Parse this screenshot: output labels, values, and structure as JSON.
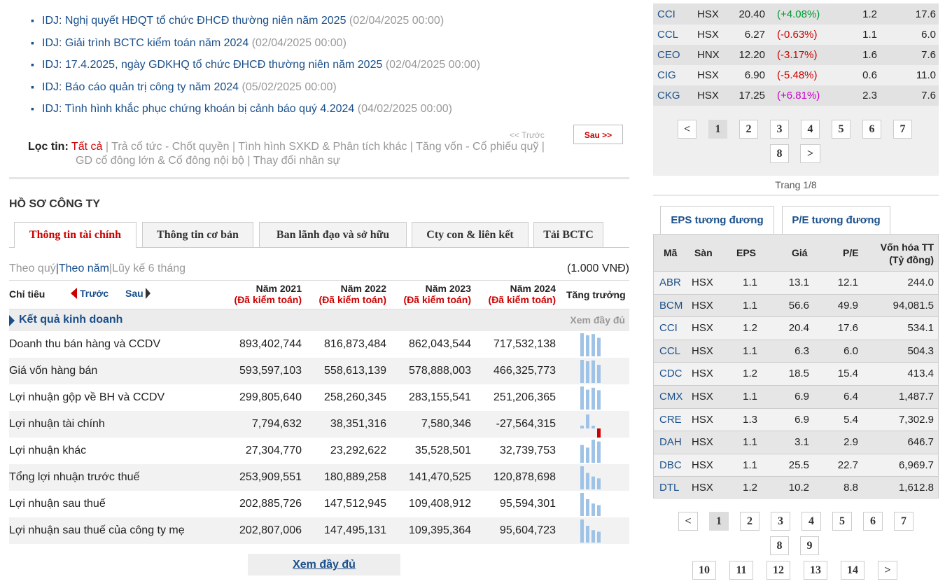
{
  "news": {
    "items": [
      {
        "text": "IDJ: Nghị quyết HĐQT tổ chức ĐHCĐ thường niên năm 2025",
        "date": "(02/04/2025 00:00)"
      },
      {
        "text": "IDJ: Giải trình BCTC kiểm toán năm 2024",
        "date": "(02/04/2025 00:00)"
      },
      {
        "text": "IDJ: 17.4.2025, ngày GDKHQ tổ chức ĐHCĐ thường niên năm 2025",
        "date": "(02/04/2025 00:00)"
      },
      {
        "text": "IDJ: Báo cáo quản trị công ty năm 2024",
        "date": "(05/02/2025 00:00)"
      },
      {
        "text": "IDJ: Tình hình khắc phục chứng khoán bị cảnh báo quý 4.2024",
        "date": "(04/02/2025 00:00)"
      }
    ],
    "prev_label": "<< Trước",
    "next_label": "Sau >>",
    "filter": {
      "label": "Lọc tin",
      "colon": ":",
      "items": [
        "Tất cả",
        "Trả cổ tức - Chốt quyền",
        "Tình hình SXKD & Phân tích khác",
        "Tăng vốn - Cổ phiếu quỹ",
        "GD cổ đông lớn & Cổ đông nội bộ",
        "Thay đổi nhân sự"
      ],
      "separator": " | "
    }
  },
  "profile": {
    "title": "HỒ SƠ CÔNG TY",
    "tabs": [
      "Thông tin tài chính",
      "Thông tin cơ bản",
      "Ban lãnh đạo và sở hữu",
      "Cty con & liên kết",
      "Tải BCTC"
    ],
    "period": {
      "quarter": "Theo quý",
      "year": "Theo năm",
      "ytd": "Lũy kế 6 tháng",
      "sep": "|"
    },
    "unit": "(1.000 VNĐ)",
    "header": {
      "indicator": "Chỉ tiêu",
      "prev": "Trước",
      "next": "Sau",
      "growth": "Tăng trưởng",
      "years": [
        {
          "year": "Năm 2021",
          "audit": "(Đã kiểm toán)"
        },
        {
          "year": "Năm 2022",
          "audit": "(Đã kiểm toán)"
        },
        {
          "year": "Năm 2023",
          "audit": "(Đã kiểm toán)"
        },
        {
          "year": "Năm 2024",
          "audit": "(Đã kiểm toán)"
        }
      ]
    },
    "group": {
      "title": "Kết quả kinh doanh",
      "view_full": "Xem đầy đủ"
    },
    "rows": [
      {
        "name": "Doanh thu bán hàng và CCDV",
        "values": [
          "893,402,744",
          "816,873,484",
          "862,043,544",
          "717,532,138"
        ],
        "nums": [
          893402744,
          816873484,
          862043544,
          717532138
        ]
      },
      {
        "name": "Giá vốn hàng bán",
        "values": [
          "593,597,103",
          "558,613,139",
          "578,888,003",
          "466,325,773"
        ],
        "nums": [
          593597103,
          558613139,
          578888003,
          466325773
        ]
      },
      {
        "name": "Lợi nhuận gộp về BH và CCDV",
        "values": [
          "299,805,640",
          "258,260,345",
          "283,155,541",
          "251,206,365"
        ],
        "nums": [
          299805640,
          258260345,
          283155541,
          251206365
        ]
      },
      {
        "name": "Lợi nhuận tài chính",
        "values": [
          "7,794,632",
          "38,351,316",
          "7,580,346",
          "-27,564,315"
        ],
        "nums": [
          7794632,
          38351316,
          7580346,
          -27564315
        ]
      },
      {
        "name": "Lợi nhuận khác",
        "values": [
          "27,304,770",
          "23,292,622",
          "35,528,501",
          "32,739,753"
        ],
        "nums": [
          27304770,
          23292622,
          35528501,
          32739753
        ]
      },
      {
        "name": "Tổng lợi nhuận trước thuế",
        "values": [
          "253,909,551",
          "180,889,258",
          "141,470,525",
          "120,878,698"
        ],
        "nums": [
          253909551,
          180889258,
          141470525,
          120878698
        ]
      },
      {
        "name": "Lợi nhuận sau thuế",
        "values": [
          "202,885,726",
          "147,512,945",
          "109,408,912",
          "95,594,301"
        ],
        "nums": [
          202885726,
          147512945,
          109408912,
          95594301
        ]
      },
      {
        "name": "Lợi nhuận sau thuế của công ty mẹ",
        "values": [
          "202,807,006",
          "147,495,131",
          "109,395,364",
          "95,604,723"
        ],
        "nums": [
          202807006,
          147495131,
          109395364,
          95604723
        ]
      }
    ],
    "more": "Xem đầy đủ"
  },
  "quotes": {
    "rows": [
      {
        "ticker": "CCI",
        "exchange": "HSX",
        "price": "20.40",
        "change": "(+4.08%)",
        "dir": "up",
        "c1": "1.2",
        "c2": "17.6"
      },
      {
        "ticker": "CCL",
        "exchange": "HSX",
        "price": "6.27",
        "change": "(-0.63%)",
        "dir": "dn",
        "c1": "1.1",
        "c2": "6.0"
      },
      {
        "ticker": "CEO",
        "exchange": "HNX",
        "price": "12.20",
        "change": "(-3.17%)",
        "dir": "dn",
        "c1": "1.6",
        "c2": "7.6"
      },
      {
        "ticker": "CIG",
        "exchange": "HSX",
        "price": "6.90",
        "change": "(-5.48%)",
        "dir": "dn",
        "c1": "0.6",
        "c2": "11.0"
      },
      {
        "ticker": "CKG",
        "exchange": "HSX",
        "price": "17.25",
        "change": "(+6.81%)",
        "dir": "ce",
        "c1": "2.3",
        "c2": "7.6"
      }
    ],
    "pages": [
      "<",
      "1",
      "2",
      "3",
      "4",
      "5",
      "6",
      "7",
      "8",
      ">"
    ],
    "current_page": "1",
    "page_of": "Trang 1/8"
  },
  "eps": {
    "tabs": [
      "EPS tương đương",
      "P/E tương đương"
    ],
    "headers": {
      "ticker": "Mã",
      "exchange": "Sàn",
      "eps": "EPS",
      "price": "Giá",
      "pe": "P/E",
      "cap1": "Vốn hóa TT",
      "cap2": "(Tỷ đồng)"
    },
    "rows": [
      {
        "ticker": "ABR",
        "exchange": "HSX",
        "eps": "1.1",
        "price": "13.1",
        "pe": "12.1",
        "cap": "244.0"
      },
      {
        "ticker": "BCM",
        "exchange": "HSX",
        "eps": "1.1",
        "price": "56.6",
        "pe": "49.9",
        "cap": "94,081.5"
      },
      {
        "ticker": "CCI",
        "exchange": "HSX",
        "eps": "1.2",
        "price": "20.4",
        "pe": "17.6",
        "cap": "534.1"
      },
      {
        "ticker": "CCL",
        "exchange": "HSX",
        "eps": "1.1",
        "price": "6.3",
        "pe": "6.0",
        "cap": "504.3"
      },
      {
        "ticker": "CDC",
        "exchange": "HSX",
        "eps": "1.2",
        "price": "18.5",
        "pe": "15.4",
        "cap": "413.4"
      },
      {
        "ticker": "CMX",
        "exchange": "HSX",
        "eps": "1.1",
        "price": "6.9",
        "pe": "6.4",
        "cap": "1,487.7"
      },
      {
        "ticker": "CRE",
        "exchange": "HSX",
        "eps": "1.3",
        "price": "6.9",
        "pe": "5.4",
        "cap": "7,302.9"
      },
      {
        "ticker": "DAH",
        "exchange": "HSX",
        "eps": "1.1",
        "price": "3.1",
        "pe": "2.9",
        "cap": "646.7"
      },
      {
        "ticker": "DBC",
        "exchange": "HSX",
        "eps": "1.1",
        "price": "25.5",
        "pe": "22.7",
        "cap": "6,969.7"
      },
      {
        "ticker": "DTL",
        "exchange": "HSX",
        "eps": "1.2",
        "price": "10.2",
        "pe": "8.8",
        "cap": "1,612.8"
      }
    ],
    "pages": [
      "<",
      "1",
      "2",
      "3",
      "4",
      "5",
      "6",
      "7",
      "8",
      "9",
      "10",
      "11",
      "12",
      "13",
      "14",
      ">"
    ],
    "current_page": "1"
  },
  "colors": {
    "accent_red": "#cc0000",
    "link_blue": "#1a4f8a",
    "bar_blue": "#9ec3e6",
    "bar_red": "#cc0000"
  }
}
